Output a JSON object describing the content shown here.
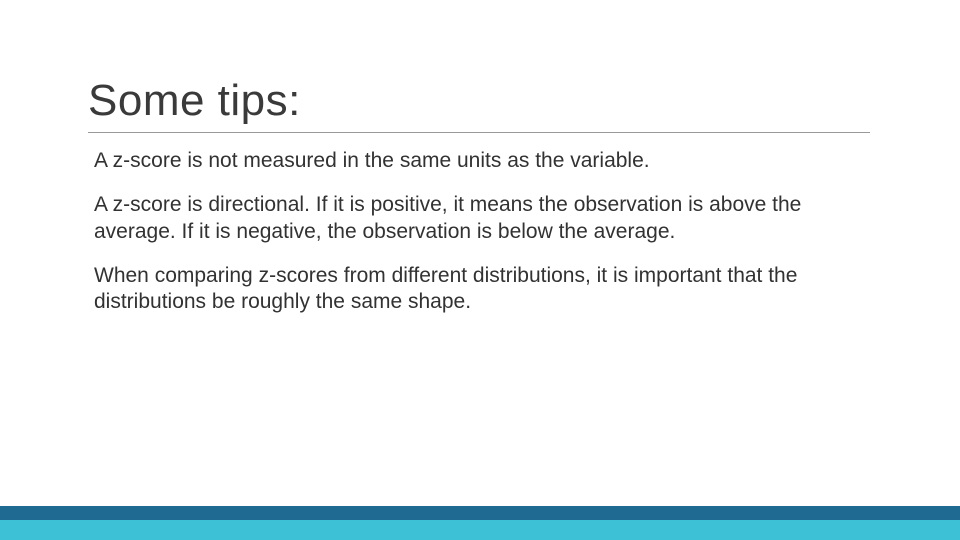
{
  "slide": {
    "title": "Some tips:",
    "paragraphs": [
      "A z-score is not measured in the same units as the variable.",
      "A z-score is directional.  If it is positive, it means the observation is above the average.  If it is negative, the observation is below the average.",
      "When comparing z-scores from different distributions, it is important that the distributions be roughly the same shape."
    ]
  },
  "colors": {
    "bar_dark": "#1e6a93",
    "bar_light": "#3cc1d6"
  }
}
